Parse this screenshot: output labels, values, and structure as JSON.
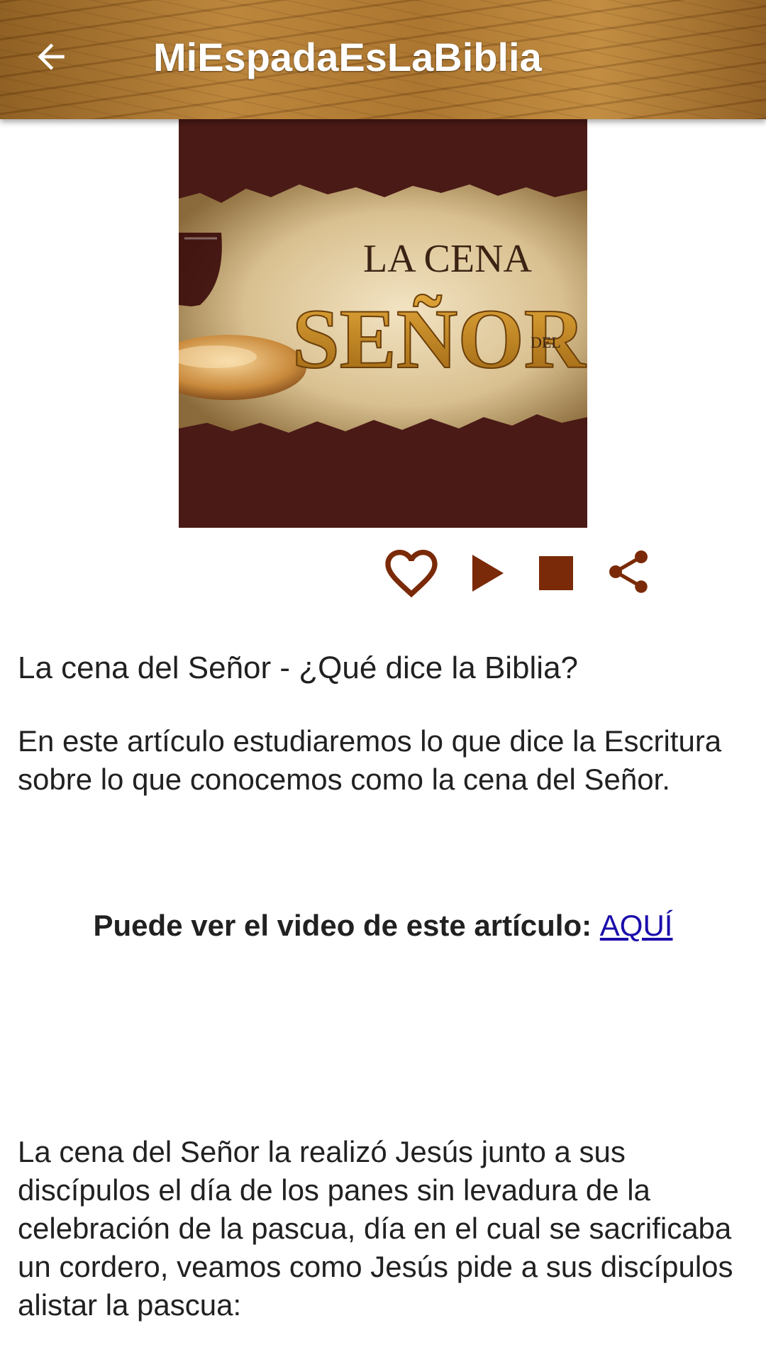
{
  "appbar": {
    "title": "MiEspadaEsLaBiblia",
    "back_icon": "arrow-back-icon"
  },
  "hero": {
    "line1": "LA CENA",
    "line2": "SEÑOR",
    "line3": "DEL"
  },
  "actions": {
    "favorite_icon": "heart-outline-icon",
    "play_icon": "play-icon",
    "stop_icon": "stop-icon",
    "share_icon": "share-icon",
    "color": "#7a2a08"
  },
  "article": {
    "title": "La cena del Señor - ¿Qué dice la Biblia?",
    "intro": "En este artículo estudiaremos lo que dice la Escritura sobre lo que conocemos como la cena del Señor.",
    "video_label": "Puede ver el video de este artículo: ",
    "video_link": "AQUÍ",
    "paragraph": "La cena del Señor la realizó Jesús junto a sus discípulos el día de los panes sin levadura de la celebración de la pascua, día en el cual se sacrificaba un cordero, veamos como Jesús pide a sus discípulos alistar la pascua:"
  }
}
